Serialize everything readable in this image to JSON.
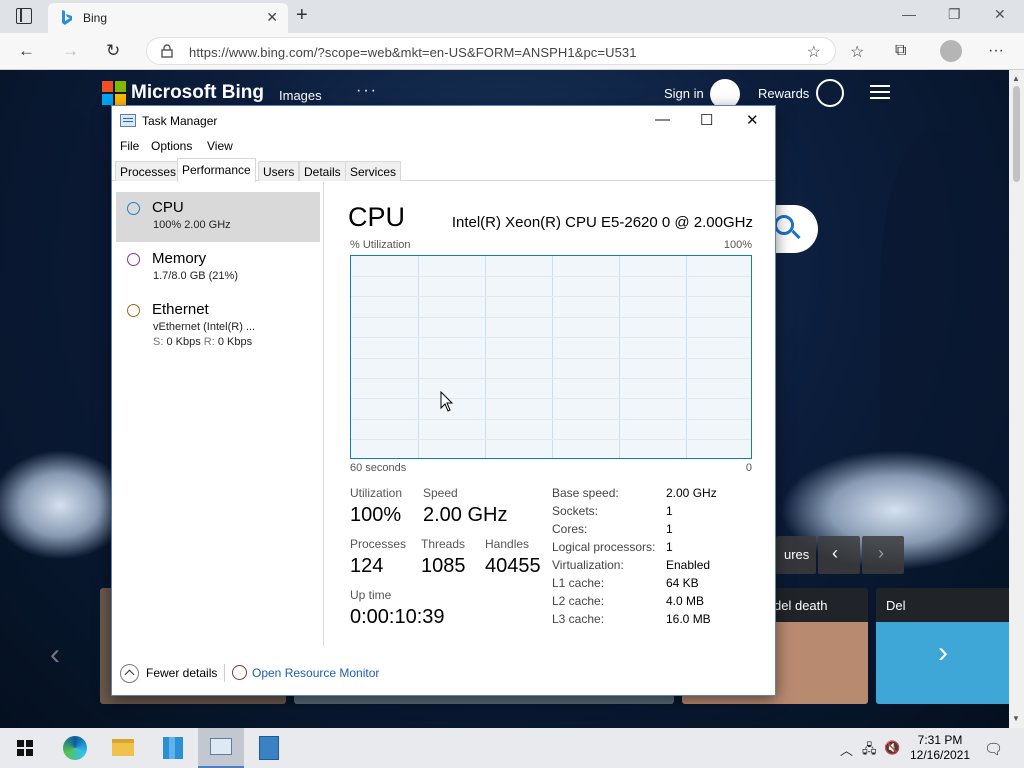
{
  "browser": {
    "tab_title": "Bing",
    "url": "https://www.bing.com/?scope=web&mkt=en-US&FORM=ANSPH1&pc=U531"
  },
  "bing": {
    "brand": "Microsoft Bing",
    "nav_images": "Images",
    "nav_more": "···",
    "signin": "Sign in",
    "rewards": "Rewards",
    "pill_label": "ures",
    "cards": [
      {
        "label": "del death"
      },
      {
        "label": "Del"
      }
    ]
  },
  "task_manager": {
    "title": "Task Manager",
    "menu": [
      "File",
      "Options",
      "View"
    ],
    "tabs": [
      "Processes",
      "Performance",
      "Users",
      "Details",
      "Services"
    ],
    "active_tab": "Performance",
    "sidebar": [
      {
        "name": "CPU",
        "sub": "100%  2.00 GHz",
        "ring_color": "#1f7fc4"
      },
      {
        "name": "Memory",
        "sub": "1.7/8.0 GB (21%)",
        "ring_color": "#8b2ea0"
      },
      {
        "name": "Ethernet",
        "sub": "vEthernet (Intel(R) ...",
        "sub2_s_label": "S:",
        "sub2_s_value": "0 Kbps",
        "sub2_r_label": "R:",
        "sub2_r_value": "0 Kbps",
        "ring_color": "#a66418"
      }
    ],
    "cpu": {
      "heading": "CPU",
      "model": "Intel(R) Xeon(R) CPU E5-2620 0 @ 2.00GHz",
      "graph_y_label": "% Utilization",
      "graph_y_max": "100%",
      "graph_x_left": "60 seconds",
      "graph_x_right": "0",
      "utilization_label": "Utilization",
      "utilization": "100%",
      "speed_label": "Speed",
      "speed": "2.00 GHz",
      "processes_label": "Processes",
      "processes": "124",
      "threads_label": "Threads",
      "threads": "1085",
      "handles_label": "Handles",
      "handles": "40455",
      "uptime_label": "Up time",
      "uptime": "0:00:10:39",
      "details": [
        {
          "k": "Base speed:",
          "v": "2.00 GHz"
        },
        {
          "k": "Sockets:",
          "v": "1"
        },
        {
          "k": "Cores:",
          "v": "1"
        },
        {
          "k": "Logical processors:",
          "v": "1"
        },
        {
          "k": "Virtualization:",
          "v": "Enabled"
        },
        {
          "k": "L1 cache:",
          "v": "64 KB"
        },
        {
          "k": "L2 cache:",
          "v": "4.0 MB"
        },
        {
          "k": "L3 cache:",
          "v": "16.0 MB"
        }
      ]
    },
    "footer": {
      "fewer_details": "Fewer details",
      "open_resource_monitor": "Open Resource Monitor"
    }
  },
  "taskbar": {
    "time": "7:31 PM",
    "date": "12/16/2021"
  }
}
